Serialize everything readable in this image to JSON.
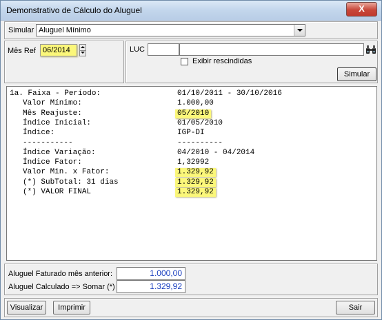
{
  "window": {
    "title": "Demonstrativo de Cálculo do Aluguel",
    "close_label": "X"
  },
  "simular_row": {
    "label": "Simular",
    "value": "Aluguel Mínimo"
  },
  "mes_ref": {
    "label": "Mês Ref",
    "value": "06/2014"
  },
  "luc": {
    "label": "LUC",
    "value1": "",
    "value2": "",
    "search_icon": "binoculars-icon"
  },
  "exibir": {
    "label": "Exibir rescindidas",
    "checked": false
  },
  "simular_button": "Simular",
  "memo": [
    {
      "label": "1a. Faixa - Período:",
      "value": "01/10/2011 - 30/10/2016",
      "indent": 0,
      "hl": false
    },
    {
      "label": "Valor Mínimo:",
      "value": "1.000,00",
      "indent": 1,
      "hl": false
    },
    {
      "label": "Mês Reajuste:",
      "value": "05/2010",
      "indent": 1,
      "hl": true
    },
    {
      "label": "Índice Inicial:",
      "value": "01/05/2010",
      "indent": 1,
      "hl": false
    },
    {
      "label": "Índice:",
      "value": "IGP-DI",
      "indent": 1,
      "hl": false
    },
    {
      "label": "-----------",
      "value": "----------",
      "indent": 1,
      "hl": false
    },
    {
      "label": "Índice Variação:",
      "value": "04/2010 - 04/2014",
      "indent": 1,
      "hl": false
    },
    {
      "label": "Índice Fator:",
      "value": "1,32992",
      "indent": 1,
      "hl": false
    },
    {
      "label": "Valor Min. x Fator:",
      "value": "1.329,92",
      "indent": 1,
      "hl": true
    },
    {
      "label": "(*) SubTotal: 31 dias",
      "value": "1.329,92",
      "indent": 1,
      "hl": true
    },
    {
      "label": "(*) VALOR FINAL",
      "value": "1.329,92",
      "indent": 1,
      "hl": true
    }
  ],
  "totals": {
    "faturado_label": "Aluguel Faturado mês anterior:",
    "faturado_value": "1.000,00",
    "calculado_label": "Aluguel Calculado => Somar (*)",
    "calculado_value": "1.329,92"
  },
  "footer": {
    "visualizar": "Visualizar",
    "imprimir": "Imprimir",
    "sair": "Sair"
  },
  "colors": {
    "highlight": "#fbf77a",
    "value_blue": "#1a3fbf"
  }
}
